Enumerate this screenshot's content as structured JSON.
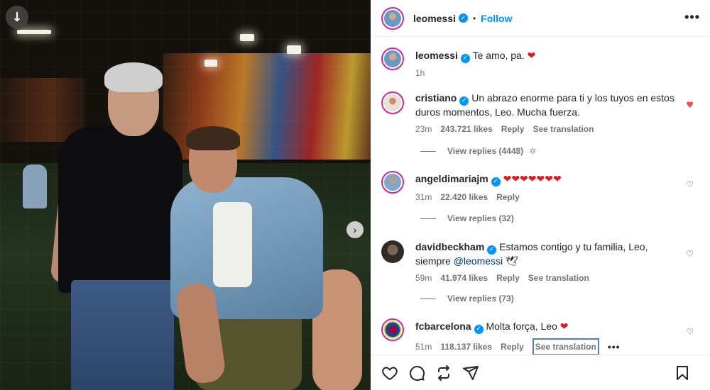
{
  "post": {
    "author": "leomessi",
    "follow_label": "Follow",
    "dot": "•",
    "more": "•••"
  },
  "photo": {
    "download_icon": "download-icon",
    "next_icon": "chevron-right-icon",
    "download_glyph": "↓",
    "next_glyph": "›"
  },
  "caption": {
    "username": "leomessi",
    "text": "Te amo, pa.",
    "emoji": "❤",
    "time": "1h"
  },
  "comments": [
    {
      "username": "cristiano",
      "text": "Un abrazo enorme para ti y los tuyos en estos duros momentos, Leo. Mucha fuerza.",
      "time": "23m",
      "likes": "243.721 likes",
      "reply": "Reply",
      "see_translation": "See translation",
      "view_replies": "View replies (4448)",
      "liked": true
    },
    {
      "username": "angeldimariajm",
      "text": "",
      "emoji": "❤❤❤❤❤❤❤",
      "time": "31m",
      "likes": "22.420 likes",
      "reply": "Reply",
      "view_replies": "View replies (32)",
      "liked": false
    },
    {
      "username": "davidbeckham",
      "text": "Estamos contigo y tu familia, Leo, siempre",
      "mention": "@leomessi",
      "emoji": "🕊",
      "time": "59m",
      "likes": "41.974 likes",
      "reply": "Reply",
      "see_translation": "See translation",
      "view_replies": "View replies (73)",
      "liked": false
    },
    {
      "username": "fcbarcelona",
      "text": "Molta força, Leo",
      "emoji": "❤",
      "time": "51m",
      "likes": "118.137 likes",
      "reply": "Reply",
      "see_translation": "See translation",
      "more": "•••",
      "liked": false
    }
  ],
  "verified_mark": "✓",
  "heart_filled": "♥",
  "heart_outline": "♡",
  "spinner": "✲",
  "actions": [
    "like-icon",
    "comment-icon",
    "share-icon",
    "send-icon",
    "save-icon"
  ],
  "colors": {
    "accent": "#0095f6",
    "like": "#ed4956",
    "verified": "#0095f6"
  }
}
